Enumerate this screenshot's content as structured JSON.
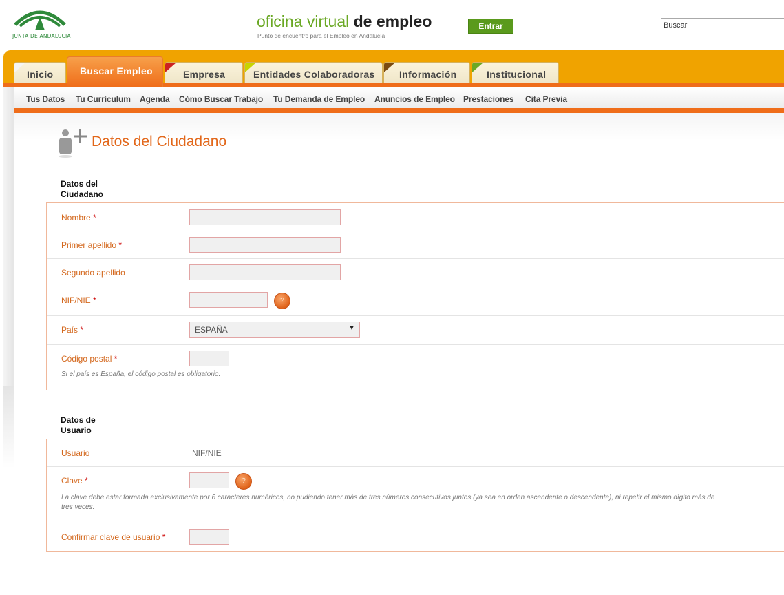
{
  "header": {
    "logo_text": "JUNTA DE ANDALUCIA",
    "brand_part1": "oficina virtual",
    "brand_part2": "de empleo",
    "brand_subtitle": "Punto de encuentro para el Empleo en Andalucía",
    "entrar_label": "Entrar",
    "search_value": "Buscar"
  },
  "tabs": [
    {
      "label": "Inicio",
      "corner": "#f5f5f5"
    },
    {
      "label": "Buscar Empleo",
      "corner": "#f7a04a",
      "active": true
    },
    {
      "label": "Empresa",
      "corner": "#cc2222"
    },
    {
      "label": "Entidades Colaboradoras",
      "corner": "#c8d400"
    },
    {
      "label": "Información",
      "corner": "#7a4a12"
    },
    {
      "label": "Institucional",
      "corner": "#6aa824"
    }
  ],
  "subnav": [
    "Tus Datos",
    "Tu Currículum",
    "Agenda",
    "Cómo Buscar Trabajo",
    "Tu Demanda de Empleo",
    "Anuncios de Empleo",
    "Prestaciones",
    "Cita Previa"
  ],
  "page_title": "Datos del Ciudadano",
  "section1": {
    "title_line1": "Datos del",
    "title_line2": "Ciudadano",
    "nombre_label": "Nombre",
    "primer_apellido_label": "Primer apellido",
    "segundo_apellido_label": "Segundo apellido",
    "nif_label": "NIF/NIE",
    "pais_label": "País",
    "pais_value": "ESPAÑA",
    "codigo_postal_label": "Código postal",
    "codigo_postal_hint": "Si el país es España, el código postal es obligatorio.",
    "required_mark": "*"
  },
  "section2": {
    "title_line1": "Datos de",
    "title_line2": "Usuario",
    "usuario_label": "Usuario",
    "usuario_value": "NIF/NIE",
    "clave_label": "Clave",
    "clave_hint_line1": "La clave debe estar formada exclusivamente por 6 caracteres numéricos, no pudiendo tener más de tres números consecutivos juntos (ya sea en orden ascendente o descendente), ni repetir el mismo dígito más de",
    "clave_hint_line2": "tres veces.",
    "confirmar_label": "Confirmar clave de usuario"
  },
  "help_glyph": "?",
  "select_arrow": "▼",
  "colors": {
    "accent_orange": "#ef6d1a",
    "tab_bar": "#f0a300",
    "brand_green": "#6aa824",
    "entrar_green": "#5a9a1c"
  }
}
